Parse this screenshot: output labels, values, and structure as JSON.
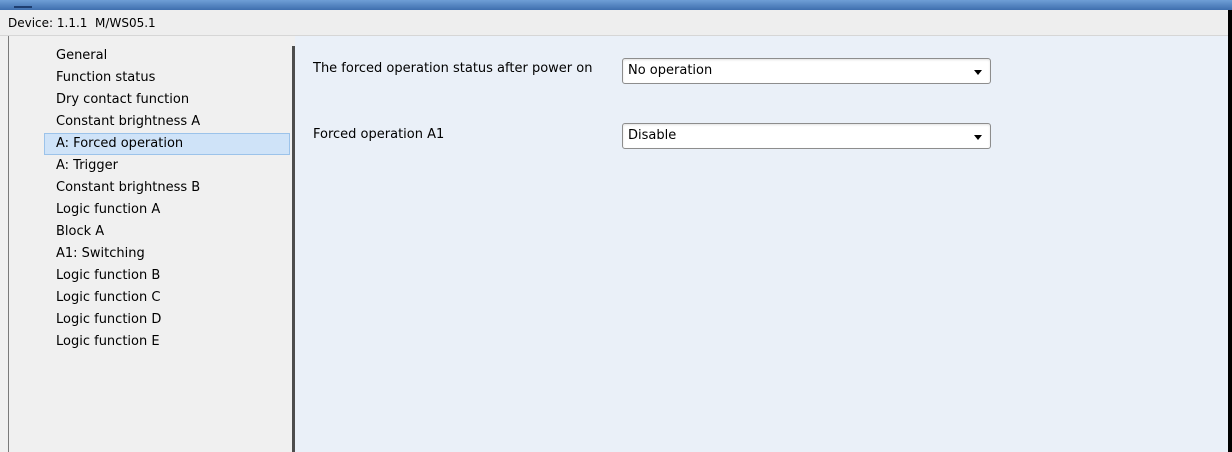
{
  "device": {
    "title": "Device: 1.1.1  M/WS05.1"
  },
  "sidebar": {
    "items": [
      {
        "label": "General",
        "selected": false
      },
      {
        "label": "Function status",
        "selected": false
      },
      {
        "label": "Dry contact function",
        "selected": false
      },
      {
        "label": "Constant brightness A",
        "selected": false
      },
      {
        "label": "A: Forced operation",
        "selected": true
      },
      {
        "label": "A: Trigger",
        "selected": false
      },
      {
        "label": "Constant brightness B",
        "selected": false
      },
      {
        "label": "Logic function A",
        "selected": false
      },
      {
        "label": "Block A",
        "selected": false
      },
      {
        "label": "A1: Switching",
        "selected": false
      },
      {
        "label": "Logic function B",
        "selected": false
      },
      {
        "label": "Logic function C",
        "selected": false
      },
      {
        "label": "Logic function D",
        "selected": false
      },
      {
        "label": "Logic function E",
        "selected": false
      }
    ]
  },
  "parameters": [
    {
      "label": "The forced operation status after power on",
      "value": "No operation"
    },
    {
      "label": "Forced operation A1",
      "value": "Disable"
    }
  ],
  "colors": {
    "panel_background": "#eaf0f8",
    "selection_background": "#cfe3f8",
    "selection_border": "#9cc3ea",
    "title_strip": "#4f80c0"
  }
}
